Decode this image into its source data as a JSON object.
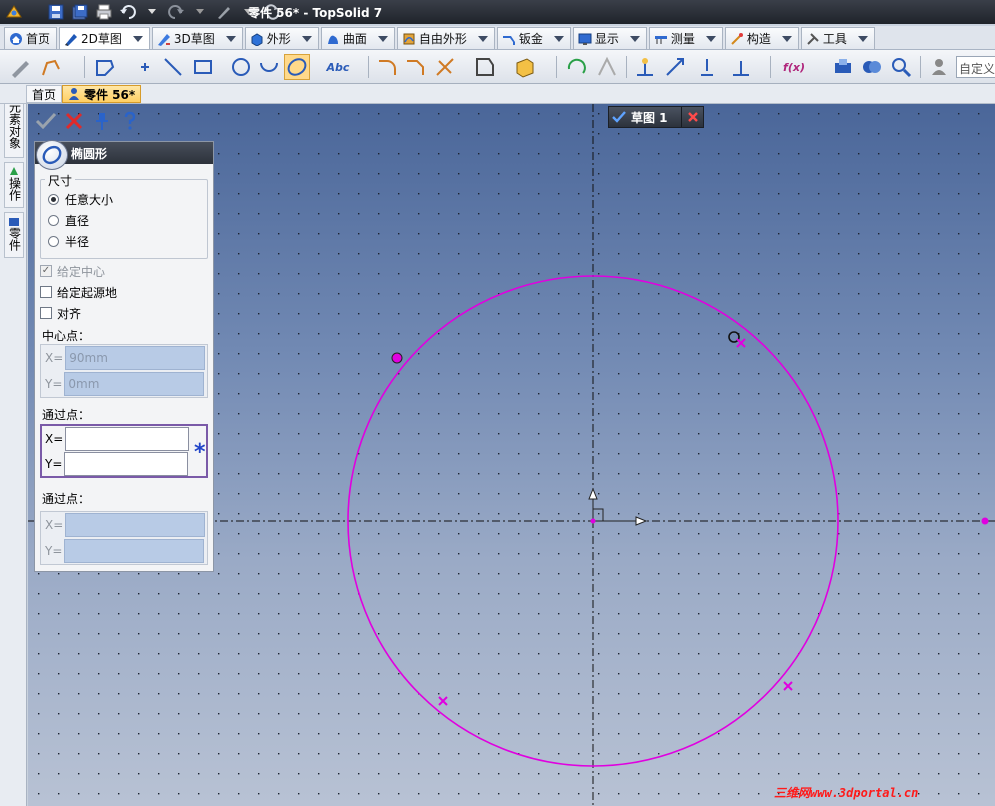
{
  "window": {
    "title": "零件 56* - TopSolid 7"
  },
  "ribbon_tabs": [
    {
      "label": "首页",
      "icon": "home-icon"
    },
    {
      "label": "2D草图",
      "icon": "pencil-icon"
    },
    {
      "label": "3D草图",
      "icon": "pencil-3d-icon"
    },
    {
      "label": "外形",
      "icon": "shape-icon"
    },
    {
      "label": "曲面",
      "icon": "surface-icon"
    },
    {
      "label": "自由外形",
      "icon": "freeform-icon"
    },
    {
      "label": "钣金",
      "icon": "sheetmetal-icon"
    },
    {
      "label": "显示",
      "icon": "display-icon"
    },
    {
      "label": "测量",
      "icon": "measure-icon"
    },
    {
      "label": "构造",
      "icon": "construct-icon"
    },
    {
      "label": "工具",
      "icon": "tools-icon"
    }
  ],
  "toolbar": {
    "custom_field": "自定义",
    "text_tool": "Abc",
    "function_tool": "f(x)"
  },
  "doc_tabs": {
    "home": "首页",
    "part": "零件 56*"
  },
  "side_tabs": [
    {
      "label": "元素对象"
    },
    {
      "label": "操作"
    },
    {
      "label": "零件"
    }
  ],
  "sketch_tab": {
    "label": "草图 1"
  },
  "panel": {
    "title": "椭圆形",
    "size_group": "尺寸",
    "size_options": [
      {
        "label": "任意大小",
        "selected": true
      },
      {
        "label": "直径",
        "selected": false
      },
      {
        "label": "半径",
        "selected": false
      }
    ],
    "checks": [
      {
        "label": "给定中心",
        "checked": true,
        "disabled": true
      },
      {
        "label": "给定起源地",
        "checked": false,
        "disabled": false
      },
      {
        "label": "对齐",
        "checked": false,
        "disabled": false
      }
    ],
    "center_label": "中心点：",
    "center": {
      "x_label": "X=",
      "x_value": "90mm",
      "y_label": "Y=",
      "y_value": "0mm"
    },
    "pass1_label": "通过点：",
    "pass1": {
      "x_label": "X=",
      "x_value": "",
      "y_label": "Y=",
      "y_value": ""
    },
    "pass2_label": "通过点：",
    "pass2": {
      "x_label": "X=",
      "x_value": "",
      "y_label": "Y=",
      "y_value": ""
    },
    "required_marker": "*"
  },
  "watermark": "三维网www.3dportal.cn",
  "colors": {
    "curve": "#e000e0",
    "viewport_top": "#4a6699",
    "viewport_bottom": "#b8c2d4",
    "accent_tab": "#ffcf63"
  }
}
